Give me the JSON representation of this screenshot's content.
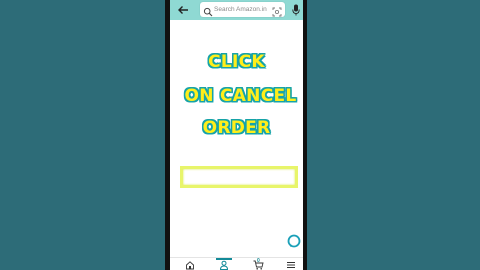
{
  "search": {
    "placeholder": "Search Amazon.in"
  },
  "overlay": {
    "line1": "CLICK",
    "line2": "ON CANCEL",
    "line3": "ORDER"
  },
  "bottom_nav": {
    "cart_count": "0",
    "items": [
      "home-icon",
      "profile-icon",
      "cart-icon",
      "menu-icon"
    ]
  },
  "colors": {
    "header": "#8fd9d3",
    "callout_text": "#ffee1a",
    "callout_outline": "#16a3a8",
    "background": "#2f6f7b"
  }
}
